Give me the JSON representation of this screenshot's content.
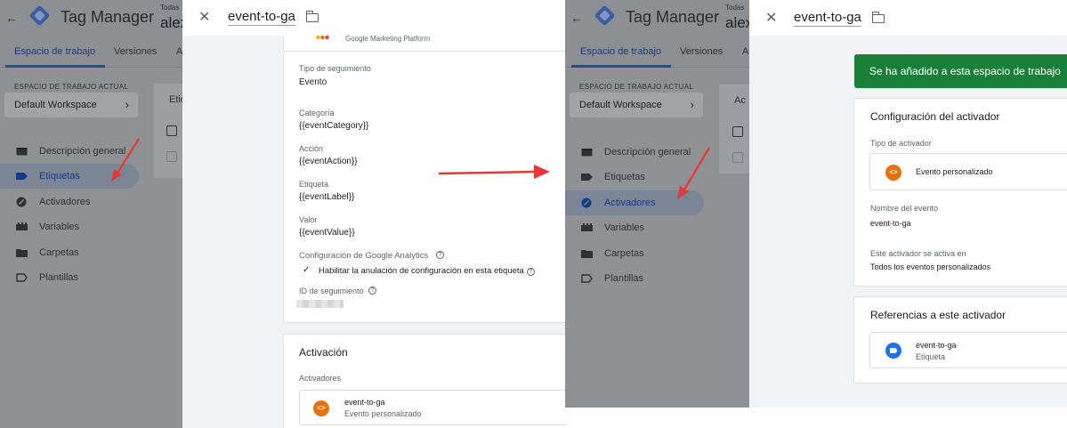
{
  "gtm": {
    "back_arrow": "←",
    "product_title": "Tag Manager",
    "account_top": "Todas",
    "account_name": "alex",
    "tabs": {
      "workspace": "Espacio de trabajo",
      "versions": "Versiones",
      "admin_peek": "A"
    },
    "workspace_label": "ESPACIO DE TRABAJO ACTUAL",
    "workspace_name": "Default Workspace",
    "workspace_chevron": "›",
    "nav": {
      "overview": "Descripción general",
      "tags": "Etiquetas",
      "triggers": "Activadores",
      "variables": "Variables",
      "folders": "Carpetas",
      "templates": "Plantillas"
    },
    "panel_peek_left": "Etiq",
    "panel_peek_right": "Ac"
  },
  "tag_editor": {
    "title": "event-to-ga",
    "platform_text": "Google Marketing Platform",
    "tracking_type_label": "Tipo de seguimiento",
    "tracking_type_value": "Evento",
    "category_label": "Categoría",
    "category_value": "{{eventCategory}}",
    "action_label": "Acción",
    "action_value": "{{eventAction}}",
    "label_label": "Etiqueta",
    "label_value": "{{eventLabel}}",
    "value_label": "Valor",
    "value_value": "{{eventValue}}",
    "ga_settings_label": "Configuración de Google Analytics",
    "override_check": "✓",
    "override_text": "Habilitar la anulación de configuración en esta etiqueta",
    "tracking_id_label": "ID de seguimiento",
    "help_glyph": "?",
    "activation_title": "Activación",
    "triggers_label": "Activadores",
    "trigger_name": "event-to-ga",
    "trigger_type": "Evento personalizado",
    "trigger_glyph": "<>"
  },
  "trigger_editor": {
    "title": "event-to-ga",
    "toast": "Se ha añadido a esta espacio de trabajo",
    "config_title": "Configuración del activador",
    "type_label": "Tipo de activador",
    "type_value": "Evento personalizado",
    "type_glyph": "<>",
    "event_name_label": "Nombre del evento",
    "event_name_value": "event-to-ga",
    "fires_on_label": "Este activador se activa en",
    "fires_on_value": "Todos los eventos personalizados",
    "refs_title": "Referencias a este activador",
    "ref_name": "event-to-ga",
    "ref_type": "Etiqueta"
  },
  "close_glyph": "✕",
  "colors": {
    "arrow": "#e53935",
    "toast": "#188038",
    "orange_icon": "#e8710a",
    "blue_icon": "#1a73e8",
    "active_tab": "#1a4ea0"
  }
}
